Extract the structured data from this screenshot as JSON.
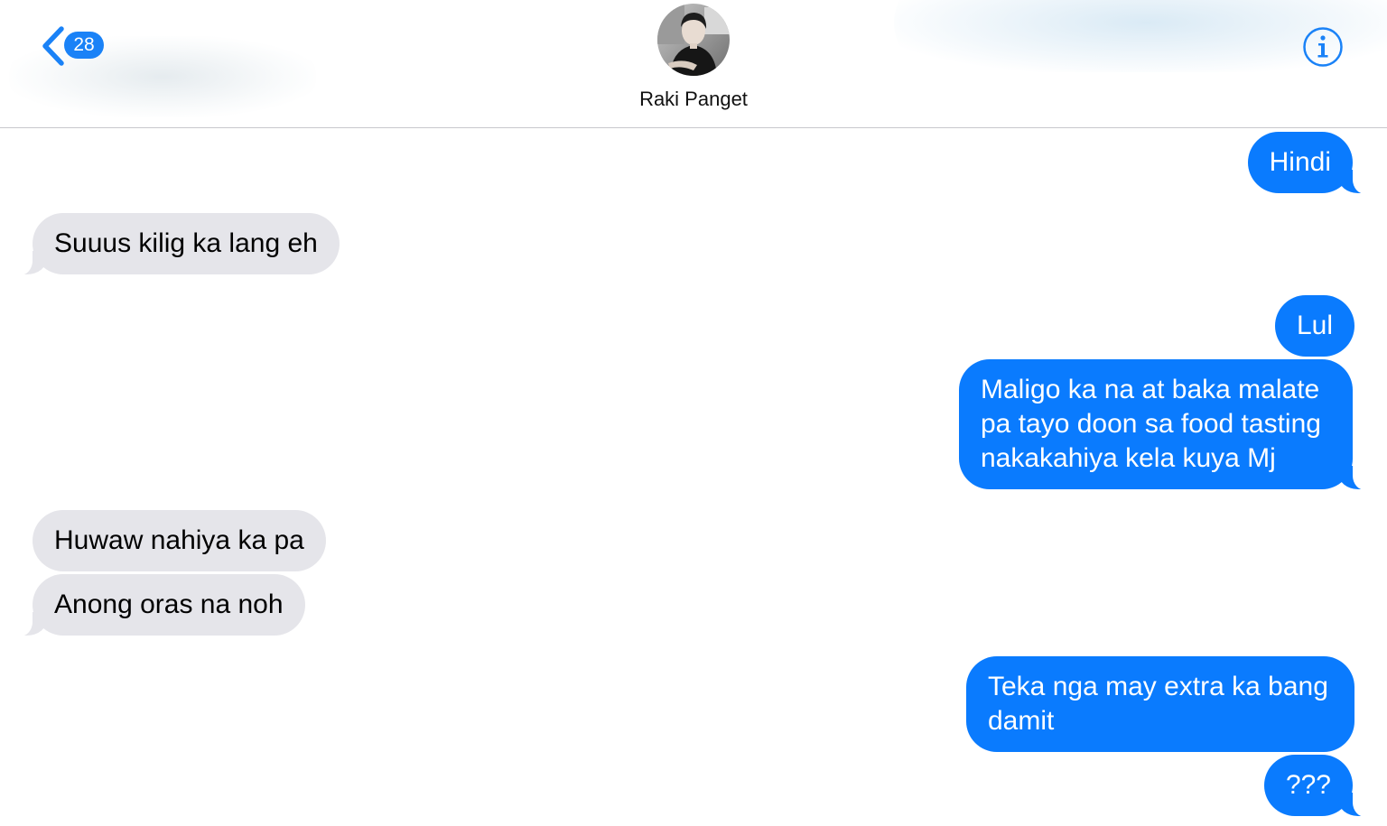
{
  "header": {
    "back_count": "28",
    "contact_name": "Raki Panget",
    "info_icon": "info-icon",
    "back_icon": "chevron-left-icon"
  },
  "colors": {
    "accent": "#0a7bfe",
    "sent_bubble": "#0a7bfe",
    "received_bubble": "#e5e5ea"
  },
  "messages": [
    {
      "direction": "sent",
      "text": "Hindi"
    },
    {
      "direction": "received",
      "text": "Suuus kilig ka lang eh"
    },
    {
      "direction": "sent",
      "text": "Lul"
    },
    {
      "direction": "sent",
      "lines": [
        "Maligo ka na at baka malate",
        "pa tayo doon sa food tasting",
        "nakakahiya kela kuya Mj"
      ]
    },
    {
      "direction": "received",
      "text": "Huwaw nahiya ka pa"
    },
    {
      "direction": "received",
      "text": "Anong oras na noh"
    },
    {
      "direction": "sent",
      "lines": [
        "Teka nga may extra ka bang",
        "damit"
      ]
    },
    {
      "direction": "sent",
      "text": "???"
    }
  ]
}
